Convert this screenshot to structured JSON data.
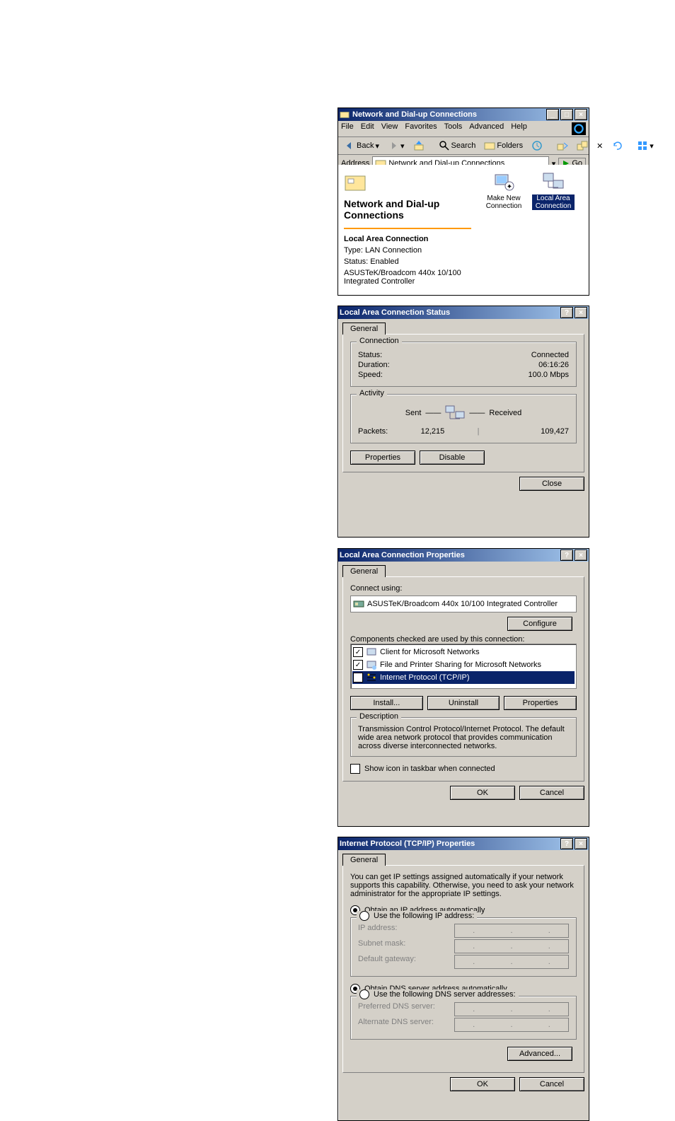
{
  "window1": {
    "title": "Network and Dial-up Connections",
    "menus": [
      "File",
      "Edit",
      "View",
      "Favorites",
      "Tools",
      "Advanced",
      "Help"
    ],
    "toolbar": {
      "back": "Back",
      "search": "Search",
      "folders": "Folders",
      "history": ""
    },
    "address_label": "Address",
    "address_value": "Network and Dial-up Connections",
    "go": "Go",
    "side_title": "Network and Dial-up Connections",
    "side_heading": "Local Area Connection",
    "side_type": "Type: LAN Connection",
    "side_status": "Status: Enabled",
    "side_device": "ASUSTeK/Broadcom 440x 10/100 Integrated Controller",
    "icons": [
      {
        "name": "Make New Connection",
        "selected": false
      },
      {
        "name": "Local Area Connection",
        "selected": true
      }
    ]
  },
  "window2": {
    "title": "Local Area Connection Status",
    "tab": "General",
    "connection": {
      "legend": "Connection",
      "status_l": "Status:",
      "status_v": "Connected",
      "duration_l": "Duration:",
      "duration_v": "06:16:26",
      "speed_l": "Speed:",
      "speed_v": "100.0 Mbps"
    },
    "activity": {
      "legend": "Activity",
      "sent": "Sent",
      "received": "Received",
      "packets_l": "Packets:",
      "sent_v": "12,215",
      "recv_v": "109,427"
    },
    "properties": "Properties",
    "disable": "Disable",
    "close": "Close"
  },
  "window3": {
    "title": "Local Area Connection Properties",
    "tab": "General",
    "connect_using": "Connect using:",
    "adapter": "ASUSTeK/Broadcom 440x 10/100 Integrated Controller",
    "configure": "Configure",
    "components_label": "Components checked are used by this connection:",
    "components": [
      {
        "name": "Client for Microsoft Networks",
        "sel": false
      },
      {
        "name": "File and Printer Sharing for Microsoft Networks",
        "sel": false
      },
      {
        "name": "Internet Protocol (TCP/IP)",
        "sel": true
      }
    ],
    "install": "Install...",
    "uninstall": "Uninstall",
    "properties": "Properties",
    "desc_legend": "Description",
    "desc_text": "Transmission Control Protocol/Internet Protocol. The default wide area network protocol that provides communication across diverse interconnected networks.",
    "show_icon": "Show icon in taskbar when connected",
    "ok": "OK",
    "cancel": "Cancel"
  },
  "window4": {
    "title": "Internet Protocol (TCP/IP) Properties",
    "tab": "General",
    "intro": "You can get IP settings assigned automatically if your network supports this capability. Otherwise, you need to ask your network administrator for the appropriate IP settings.",
    "r_auto_ip": "Obtain an IP address automatically",
    "r_use_ip": "Use the following IP address:",
    "ip_l": "IP address:",
    "mask_l": "Subnet mask:",
    "gw_l": "Default gateway:",
    "r_auto_dns": "Obtain DNS server address automatically",
    "r_use_dns": "Use the following DNS server addresses:",
    "pdns_l": "Preferred DNS server:",
    "adns_l": "Alternate DNS server:",
    "advanced": "Advanced...",
    "ok": "OK",
    "cancel": "Cancel"
  }
}
